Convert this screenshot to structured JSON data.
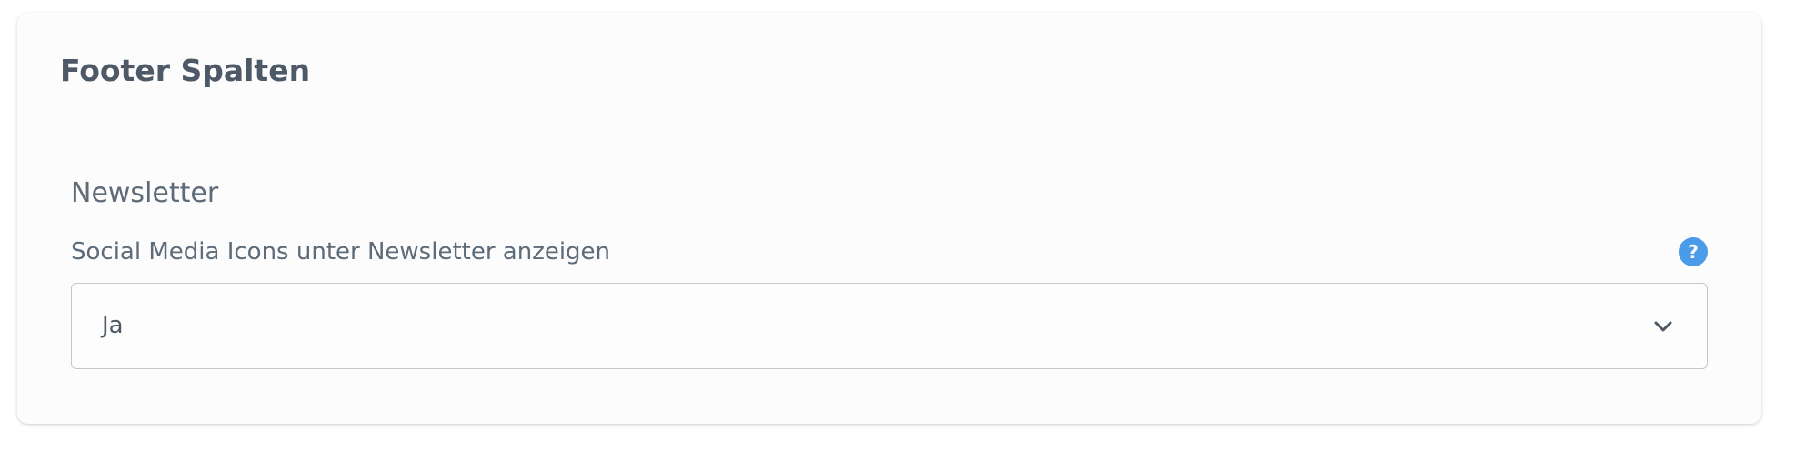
{
  "card": {
    "title": "Footer Spalten"
  },
  "section": {
    "title": "Newsletter"
  },
  "field": {
    "label": "Social Media Icons unter Newsletter anzeigen",
    "help_icon": "question-circle-icon",
    "help_glyph": "?",
    "selected_value": "Ja",
    "dropdown_icon": "chevron-down-icon"
  },
  "colors": {
    "help_icon_bg": "#4a9be8",
    "text": "#4d5966"
  }
}
